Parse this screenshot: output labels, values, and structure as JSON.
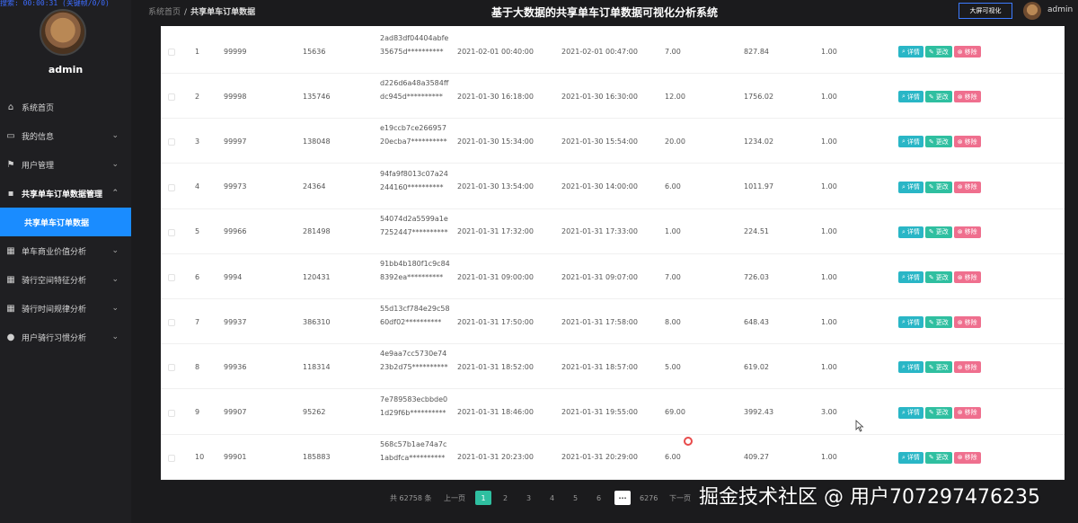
{
  "recording_banner": "搜索: 00:00:31 (关键帧/0/0)",
  "sidebar": {
    "username": "admin",
    "items": [
      {
        "label": "系统首页",
        "icon": "home-icon",
        "chevron": ""
      },
      {
        "label": "我的信息",
        "icon": "card-icon",
        "chevron": "⌄"
      },
      {
        "label": "用户管理",
        "icon": "flag-icon",
        "chevron": "⌄"
      },
      {
        "label": "共享单车订单数据管理",
        "icon": "chat-icon",
        "chevron": "⌃"
      }
    ],
    "active_sub": "共享单车订单数据",
    "items_after": [
      {
        "label": "单车商业价值分析",
        "icon": "grid-icon",
        "chevron": "⌄"
      },
      {
        "label": "骑行空间特征分析",
        "icon": "grid-icon",
        "chevron": "⌄"
      },
      {
        "label": "骑行时间规律分析",
        "icon": "grid-icon",
        "chevron": "⌄"
      },
      {
        "label": "用户骑行习惯分析",
        "icon": "person-icon",
        "chevron": "⌄"
      }
    ]
  },
  "header": {
    "breadcrumb_home": "系统首页",
    "breadcrumb_sep": "/",
    "breadcrumb_current": "共享单车订单数据",
    "title": "基于大数据的共享单车订单数据可视化分析系统",
    "bigscreen_label": "大屏可视化",
    "user": "admin"
  },
  "table": {
    "rows": [
      {
        "idx": "1",
        "id": "99999",
        "user": "15636",
        "code": "2ad83df04404abfe35675d**********",
        "start": "2021-02-01 00:40:00",
        "end": "2021-02-01 00:47:00",
        "duration": "7.00",
        "distance": "827.84",
        "fee": "1.00"
      },
      {
        "idx": "2",
        "id": "99998",
        "user": "135746",
        "code": "d226d6a48a3584ffdc945d**********",
        "start": "2021-01-30 16:18:00",
        "end": "2021-01-30 16:30:00",
        "duration": "12.00",
        "distance": "1756.02",
        "fee": "1.00"
      },
      {
        "idx": "3",
        "id": "99997",
        "user": "138048",
        "code": "e19ccb7ce26695720ecba7**********",
        "start": "2021-01-30 15:34:00",
        "end": "2021-01-30 15:54:00",
        "duration": "20.00",
        "distance": "1234.02",
        "fee": "1.00"
      },
      {
        "idx": "4",
        "id": "99973",
        "user": "24364",
        "code": "94fa9f8013c07a24244160**********",
        "start": "2021-01-30 13:54:00",
        "end": "2021-01-30 14:00:00",
        "duration": "6.00",
        "distance": "1011.97",
        "fee": "1.00"
      },
      {
        "idx": "5",
        "id": "99966",
        "user": "281498",
        "code": "54074d2a5599a1e7252447**********",
        "start": "2021-01-31 17:32:00",
        "end": "2021-01-31 17:33:00",
        "duration": "1.00",
        "distance": "224.51",
        "fee": "1.00"
      },
      {
        "idx": "6",
        "id": "9994",
        "user": "120431",
        "code": "91bb4b180f1c9c848392ea**********",
        "start": "2021-01-31 09:00:00",
        "end": "2021-01-31 09:07:00",
        "duration": "7.00",
        "distance": "726.03",
        "fee": "1.00"
      },
      {
        "idx": "7",
        "id": "99937",
        "user": "386310",
        "code": "55d13cf784e29c5860df02**********",
        "start": "2021-01-31 17:50:00",
        "end": "2021-01-31 17:58:00",
        "duration": "8.00",
        "distance": "648.43",
        "fee": "1.00"
      },
      {
        "idx": "8",
        "id": "99936",
        "user": "118314",
        "code": "4e9aa7cc5730e7423b2d75**********",
        "start": "2021-01-31 18:52:00",
        "end": "2021-01-31 18:57:00",
        "duration": "5.00",
        "distance": "619.02",
        "fee": "1.00"
      },
      {
        "idx": "9",
        "id": "99907",
        "user": "95262",
        "code": "7e789583ecbbde01d29f6b**********",
        "start": "2021-01-31 18:46:00",
        "end": "2021-01-31 19:55:00",
        "duration": "69.00",
        "distance": "3992.43",
        "fee": "3.00"
      },
      {
        "idx": "10",
        "id": "99901",
        "user": "185883",
        "code": "568c57b1ae74a7c1abdfca**********",
        "start": "2021-01-31 20:23:00",
        "end": "2021-01-31 20:29:00",
        "duration": "6.00",
        "distance": "409.27",
        "fee": "1.00"
      }
    ],
    "actions": {
      "detail": "详情",
      "edit": "更改",
      "remove": "移除"
    }
  },
  "pager": {
    "total": "共 62758 条",
    "prev": "上一页",
    "pages": [
      "1",
      "2",
      "3",
      "4",
      "5",
      "6"
    ],
    "ellipsis": "···",
    "last": "6276",
    "next": "下一页"
  },
  "watermark": "掘金技术社区 @ 用户707297476235",
  "colors": {
    "accent": "#1a8cff",
    "detail": "#29b6c6",
    "edit": "#2fbfa0",
    "remove": "#ef6f8e"
  }
}
